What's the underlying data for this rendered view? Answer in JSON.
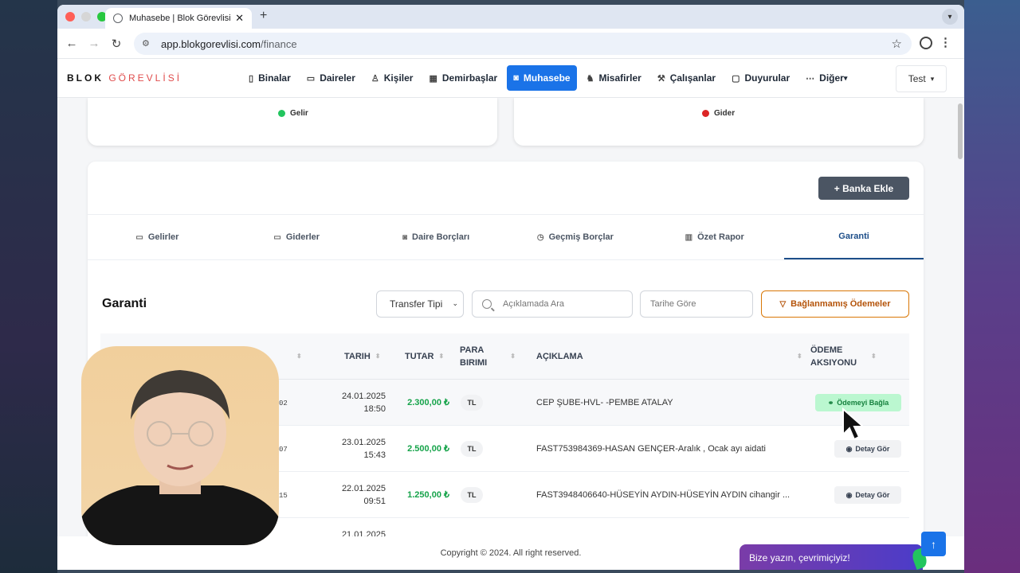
{
  "browser": {
    "tab_title": "Muhasebe | Blok Görevlisi",
    "url_host": "app.blokgorevlisi.com",
    "url_path": "/finance"
  },
  "brand": {
    "part1": "BLOK",
    "part2": "GÖREVLİSİ",
    "accent_color": "#e04c4c"
  },
  "nav": {
    "items": [
      {
        "label": "Binalar",
        "icon": "building-icon"
      },
      {
        "label": "Daireler",
        "icon": "apartment-icon"
      },
      {
        "label": "Kişiler",
        "icon": "person-icon"
      },
      {
        "label": "Demirbaşlar",
        "icon": "inventory-icon"
      },
      {
        "label": "Muhasebe",
        "icon": "finance-icon",
        "active": true
      },
      {
        "label": "Misafirler",
        "icon": "walking-icon"
      },
      {
        "label": "Çalışanlar",
        "icon": "worker-icon"
      },
      {
        "label": "Duyurular",
        "icon": "message-icon"
      },
      {
        "label": "Diğer",
        "icon": "more-icon"
      }
    ],
    "user_label": "Test",
    "active_color": "#1a73e8"
  },
  "charts": {
    "income_legend": "Gelir",
    "expense_legend": "Gider",
    "income_color": "#22c55e",
    "expense_color": "#dc2626"
  },
  "bank_button": "+ Banka Ekle",
  "finance_tabs": [
    "Gelirler",
    "Giderler",
    "Daire Borçları",
    "Geçmiş Borçlar",
    "Özet Rapor",
    "Garanti"
  ],
  "active_tab": "Garanti",
  "section_title": "Garanti",
  "filters": {
    "transfer_type": "Transfer Tipi",
    "search_placeholder": "Açıklamada Ara",
    "date_placeholder": "Tarihe Göre",
    "unlinked_button": "Bağlanmamış Ödemeler"
  },
  "table": {
    "headers": {
      "date": "TARIH",
      "amount": "TUTAR",
      "currency": "PARA BIRIMI",
      "description": "AÇIKLAMA",
      "action": "ÖDEME AKSIYONU"
    },
    "rows": [
      {
        "id_suffix": "02",
        "date": "24.01.2025",
        "time": "18:50",
        "amount": "2.300,00 ₺",
        "currency": "TL",
        "description": "CEP ŞUBE-HVL- -PEMBE ATALAY",
        "action": "Ödemeyi Bağla"
      },
      {
        "id_suffix": "07",
        "date": "23.01.2025",
        "time": "15:43",
        "amount": "2.500,00 ₺",
        "currency": "TL",
        "description": "FAST753984369-HASAN GENÇER-Aralık , Ocak ayı aidati",
        "action": "Detay Gör"
      },
      {
        "id_suffix": "15",
        "date": "22.01.2025",
        "time": "09:51",
        "amount": "1.250,00 ₺",
        "currency": "TL",
        "description": "FAST3948406640-HÜSEYİN AYDIN-HÜSEYİN AYDIN cihangir ...",
        "action": "Detay Gör"
      },
      {
        "id_suffix": "",
        "date": "21.01.2025",
        "time": "",
        "amount": "",
        "currency": "",
        "description": "",
        "action": ""
      }
    ]
  },
  "footer": "Copyright © 2024. All right reserved.",
  "chat_widget": "Bize yazın, çevrimiçiyiz!"
}
